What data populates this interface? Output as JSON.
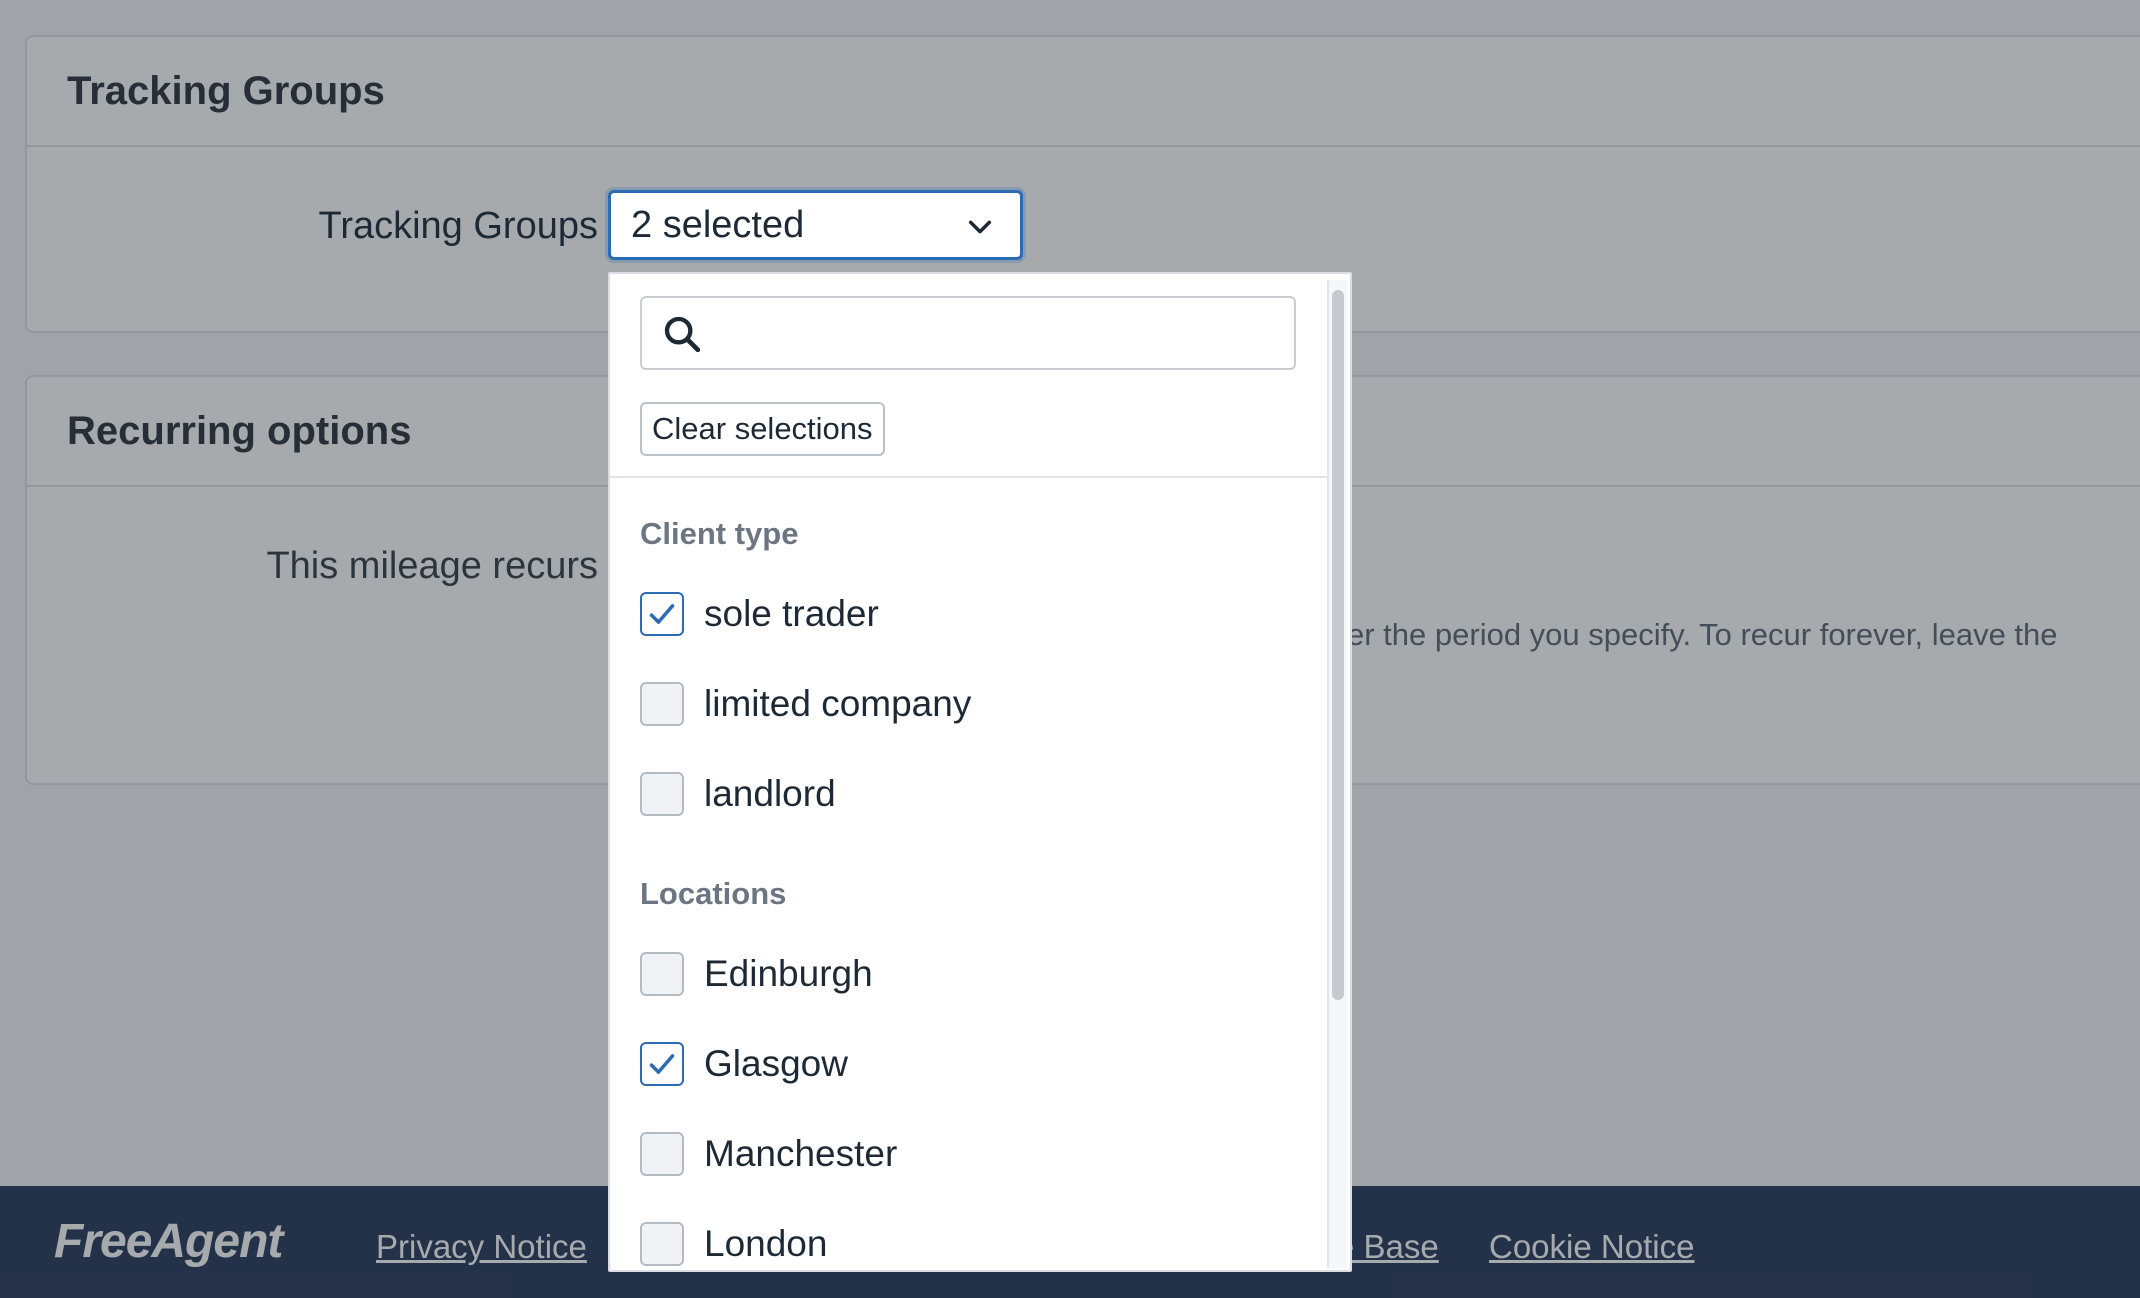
{
  "tracking_panel": {
    "title": "Tracking Groups",
    "field_label": "Tracking Groups",
    "select_value": "2 selected"
  },
  "recurring_panel": {
    "title": "Recurring options",
    "field_label": "This mileage recurs",
    "hint": "er the period you specify. To recur forever, leave the"
  },
  "dropdown": {
    "search_placeholder": "",
    "clear_label": "Clear selections",
    "groups": [
      {
        "title": "Client type",
        "options": [
          {
            "label": "sole trader",
            "checked": true
          },
          {
            "label": "limited company",
            "checked": false
          },
          {
            "label": "landlord",
            "checked": false
          }
        ]
      },
      {
        "title": "Locations",
        "options": [
          {
            "label": "Edinburgh",
            "checked": false
          },
          {
            "label": "Glasgow",
            "checked": true
          },
          {
            "label": "Manchester",
            "checked": false
          },
          {
            "label": "London",
            "checked": false
          }
        ]
      }
    ]
  },
  "footer": {
    "logo": "FreeAgent",
    "links": [
      "Privacy Notice",
      "e Base",
      "Cookie Notice"
    ]
  },
  "colors": {
    "accent": "#2c6bb3",
    "footer_bg": "#12254a"
  }
}
